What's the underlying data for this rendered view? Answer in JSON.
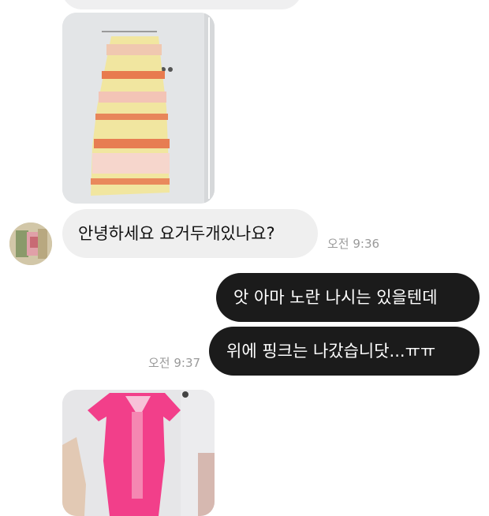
{
  "messages": {
    "incoming_text": "안녕하세요 요거두개있나요?",
    "incoming_time": "오전 9:36",
    "outgoing_1": "앗 아마 노란 나시는 있을텐데",
    "outgoing_2": "위에 핑크는 나갔습니닷...ㅠㅠ",
    "outgoing_time": "오전 9:37"
  },
  "colors": {
    "outgoing_bubble": "#1b1b1b",
    "incoming_bubble": "#efefef",
    "timestamp": "#9a9a9a"
  },
  "images": {
    "photo1": "yellow-floral-sleeveless-dress-photo",
    "photo2": "pink-dress-photo"
  }
}
